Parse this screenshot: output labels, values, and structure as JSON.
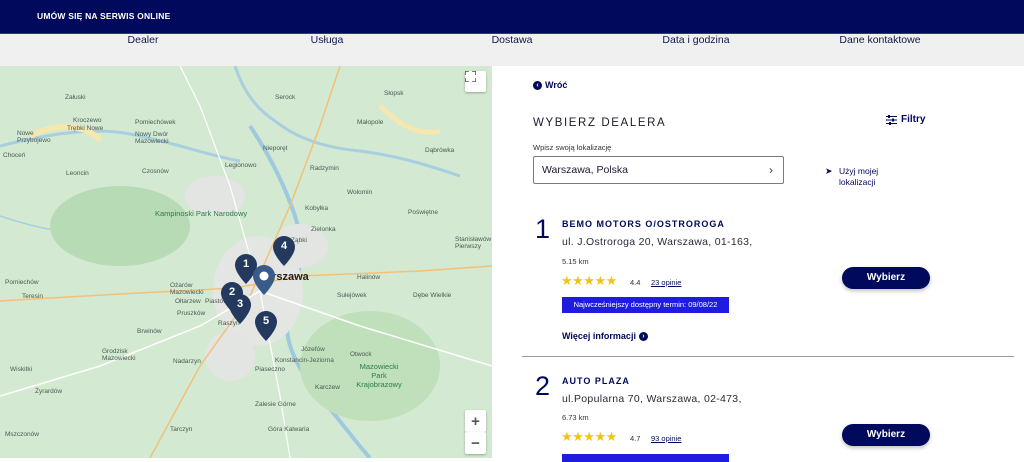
{
  "header": {
    "title": "UMÓW SIĘ NA SERWIS ONLINE",
    "bg": "#00095b"
  },
  "steps": [
    "Dealer",
    "Usługa",
    "Dostawa",
    "Data i godzina",
    "Dane kontaktowe"
  ],
  "map": {
    "labels": [
      "Załuski",
      "Kroczewo",
      "Trębki Nowe",
      "Pomiechówek",
      "Nowy Dwór Mazowiecki",
      "Nowe Przybojewo",
      "Choceń",
      "Leoncin",
      "Czosnów",
      "Kampinoski Park Narodowy",
      "Legionowo",
      "Serock",
      "Słopsk",
      "Małopole",
      "Dąbrówka",
      "Radzymin",
      "Nieporęt",
      "Kobyłka",
      "Ząbki",
      "Zielonka",
      "Wołomin",
      "Poświętne",
      "Stanisławów Pierwszy",
      "Halinów",
      "Dębe Wielkie",
      "Sulejówek",
      "Warszawa",
      "Ożarów Mazowiecki",
      "Ołtarzew",
      "Pruszków",
      "Raszyn",
      "Piastów",
      "Brwinów",
      "Nadarzyn",
      "Grodzisk Mazowiecki",
      "Konstancin-Jeziorna",
      "Józefów",
      "Otwock",
      "Karczew",
      "Piaseczno",
      "Mazowiecki Park Krajobrazowy",
      "Zalesie Górne",
      "Góra Kalwaria",
      "Tarczyn",
      "Wiskitki",
      "Żyrardów",
      "Teresin",
      "Pomiechów",
      "Mszczonów"
    ],
    "pins": [
      "1",
      "2",
      "3",
      "4",
      "5"
    ],
    "zoom_in": "+",
    "zoom_out": "−"
  },
  "panel": {
    "back_label": "Wróć",
    "heading": "WYBIERZ DEALERA",
    "filters_label": "Filtry",
    "location_label": "Wpisz swoją lokalizację",
    "location_value": "Warszawa, Polska",
    "use_location_line1": "Użyj mojej",
    "use_location_line2": "lokalizacji"
  },
  "dealers": [
    {
      "num": "1",
      "name": "BEMO MOTORS O/OSTROROGA",
      "address": "ul. J.Ostroroga 20, Warszawa, 01-163,",
      "distance": "5.15 km",
      "rating": "4.4",
      "rating_value": 4.4,
      "reviews": "23 opinie",
      "badge": "Najwcześniejszy dostępny termin: 09/08/22",
      "more": "Więcej informacji",
      "choose": "Wybierz"
    },
    {
      "num": "2",
      "name": "AUTO PLAZA",
      "address": "ul.Popularna 70, Warszawa, 02-473,",
      "distance": "6.73 km",
      "rating": "4.7",
      "rating_value": 4.7,
      "reviews": "93 opinie",
      "choose": "Wybierz"
    }
  ],
  "colors": {
    "brand": "#00095b",
    "badge": "#1f1ce0",
    "star": "#f1c40f"
  }
}
